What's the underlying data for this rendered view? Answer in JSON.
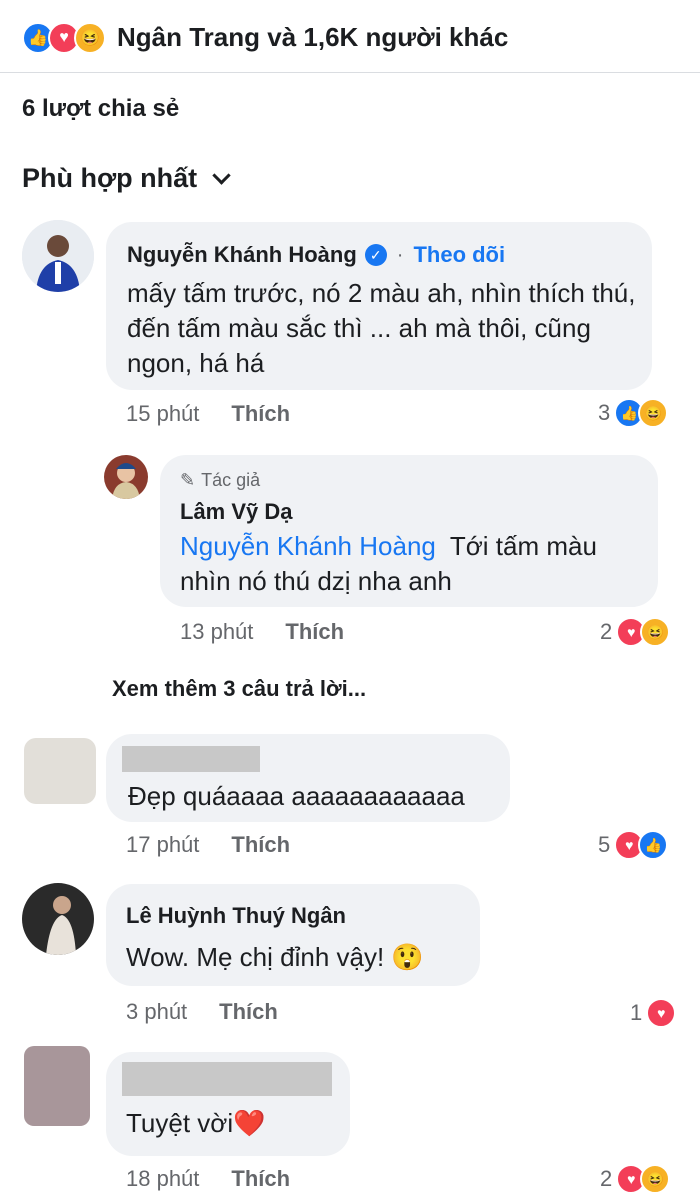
{
  "header": {
    "reactions_summary": "Ngân Trang và 1,6K người khác",
    "reaction_icons": [
      "like-icon",
      "love-icon",
      "haha-icon"
    ]
  },
  "shares": "6 lượt chia sẻ",
  "sort": {
    "label": "Phù hợp nhất"
  },
  "comments": [
    {
      "author": "Nguyễn Khánh Hoàng",
      "verified": true,
      "follow_label": "Theo dõi",
      "text": "mấy tấm trước, nó 2 màu ah, nhìn thích thú, đến tấm màu sắc thì ... ah mà thôi, cũng ngon, há há",
      "time": "15 phút",
      "like_label": "Thích",
      "reaction_count": "3",
      "reactions": [
        "like-icon",
        "haha-icon"
      ]
    },
    {
      "badge": "Tác giả",
      "author": "Lâm Vỹ Dạ",
      "mention": "Nguyễn Khánh Hoàng",
      "text": "Tới tấm màu nhìn nó thú dzị nha anh",
      "time": "13 phút",
      "like_label": "Thích",
      "reaction_count": "2",
      "reactions": [
        "love-icon",
        "haha-icon"
      ]
    },
    {
      "text": "Đẹp quáaaaa aaaaaaaaaaaa",
      "time": "17 phút",
      "like_label": "Thích",
      "reaction_count": "5",
      "reactions": [
        "love-icon",
        "like-icon"
      ]
    },
    {
      "author": "Lê Huỳnh Thuý Ngân",
      "text": "Wow. Mẹ chị đỉnh vậy! 😲",
      "time": "3 phút",
      "like_label": "Thích",
      "reaction_count": "1",
      "reactions": [
        "love-icon"
      ]
    },
    {
      "text": "Tuyệt vời❤️",
      "time": "18 phút",
      "like_label": "Thích",
      "reaction_count": "2",
      "reactions": [
        "love-icon",
        "haha-icon"
      ]
    }
  ],
  "more_replies": "Xem thêm 3 câu trả lời...",
  "colors": {
    "brand_blue": "#1877f2",
    "bubble": "#f0f2f5",
    "love": "#f33e58",
    "haha": "#f7b125"
  }
}
